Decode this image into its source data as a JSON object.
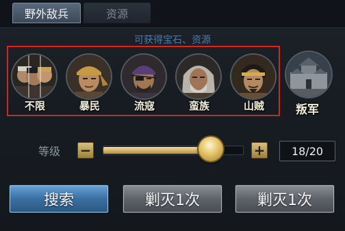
{
  "tabs": [
    {
      "label": "野外敌兵",
      "active": true
    },
    {
      "label": "资源",
      "active": false
    }
  ],
  "hint": "可获得宝石、资源",
  "enemies": [
    {
      "label": "不限",
      "icon": "group-portrait-icon"
    },
    {
      "label": "暴民",
      "icon": "bandana-man-portrait-icon"
    },
    {
      "label": "流寇",
      "icon": "eyepatch-bandit-portrait-icon"
    },
    {
      "label": "蛮族",
      "icon": "barbarian-portrait-icon"
    },
    {
      "label": "山贼",
      "icon": "mountain-bandit-portrait-icon"
    }
  ],
  "rebel": {
    "label": "叛军",
    "icon": "fortress-icon"
  },
  "level": {
    "label": "等级",
    "minus": "−",
    "plus": "+",
    "value": 18,
    "max": 20,
    "display": "18/20"
  },
  "buttons": {
    "search": "搜索",
    "annihilate_1": "剿灭1次",
    "annihilate_2": "剿灭1次"
  },
  "colors": {
    "highlight_box": "#d9231e",
    "hint_text": "#4a7bb0",
    "search_button": "#3a6fa2",
    "slider_gold": "#d4b158"
  }
}
